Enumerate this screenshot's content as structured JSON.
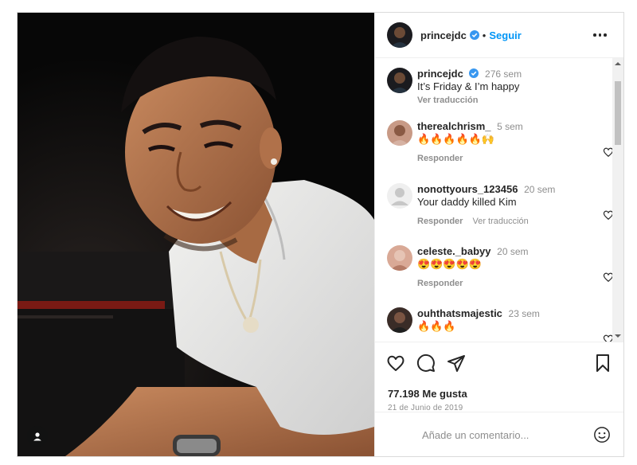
{
  "post": {
    "username": "princejdc",
    "follow_label": "Seguir",
    "separator": "•"
  },
  "caption": {
    "username": "princejdc",
    "time": "276 sem",
    "text": "It’s Friday & I’m happy",
    "translate": "Ver traducción"
  },
  "comments": [
    {
      "username": "therealchrism_",
      "time": "5 sem",
      "text": "🔥🔥🔥🔥🔥🙌",
      "reply": "Responder",
      "translate": ""
    },
    {
      "username": "nonottyours_123456",
      "time": "20 sem",
      "text": "Your daddy killed Kim",
      "reply": "Responder",
      "translate": "Ver traducción"
    },
    {
      "username": "celeste._babyy",
      "time": "20 sem",
      "text": "😍😍😍😍😍",
      "reply": "Responder",
      "translate": ""
    },
    {
      "username": "ouhthatsmajestic",
      "time": "23 sem",
      "text": "🔥🔥🔥",
      "reply": "",
      "translate": ""
    }
  ],
  "stats": {
    "likes": "77.198 Me gusta",
    "date": "21 de Junio de 2019"
  },
  "composer": {
    "placeholder": "Añade un comentario..."
  },
  "icons": {
    "like": "heart-icon",
    "comment": "comment-icon",
    "share": "share-icon",
    "save": "bookmark-icon",
    "more": "more-options-icon",
    "emoji": "emoji-icon",
    "tag": "user-tag-icon"
  },
  "colors": {
    "accent": "#0095f6",
    "muted": "#8e8e8e",
    "text": "#262626"
  }
}
